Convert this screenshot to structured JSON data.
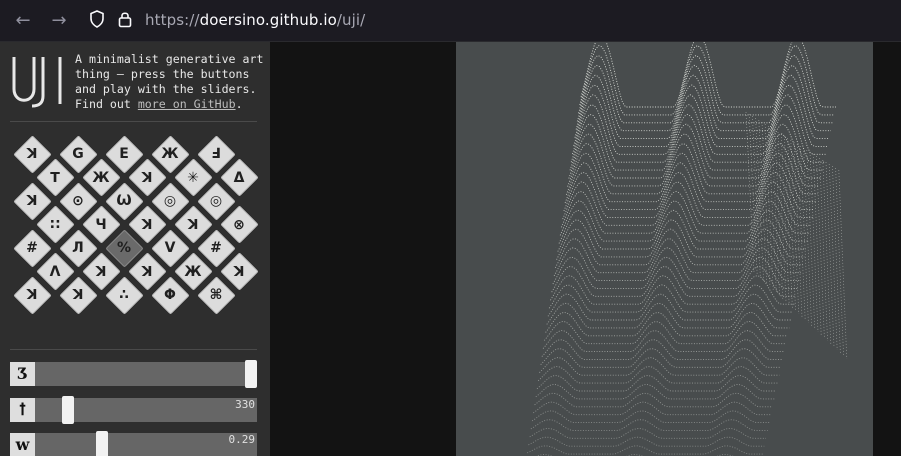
{
  "browser": {
    "url_prefix": "https://",
    "url_host": "doersino.github.io",
    "url_path": "/uji/",
    "icons": [
      "back-arrow-icon",
      "forward-arrow-icon",
      "shield-icon",
      "lock-icon"
    ]
  },
  "intro": {
    "text": "A minimalist generative art thing – press the buttons and play with the sliders. Find out ",
    "link": "more on GitHub",
    "end": "."
  },
  "presets": [
    [
      "ꓘ",
      "G",
      "E",
      "Ж",
      "Ⅎ"
    ],
    [
      "ꓔ",
      "Ж",
      "ꓘ",
      "✳",
      "Δ",
      "⊘"
    ],
    [
      "ꓘ",
      "⊙",
      "Ѡ",
      "◎",
      "◎",
      "∷"
    ],
    [
      "∷",
      "Ч",
      "ꓘ",
      "ꓘ",
      "⊗"
    ],
    [
      "#",
      "Л",
      "%",
      "V",
      "#"
    ],
    [
      "Λ",
      "ꓘ",
      "ꓘ",
      "Ж",
      "ꓘ"
    ],
    [
      "ꓘ",
      "ꓘ",
      "∴",
      "Φ",
      "⌘"
    ]
  ],
  "selected_preset": "row4-col2",
  "sliders": [
    {
      "icon": "Ʒ",
      "value": "",
      "fraction": 1.0
    },
    {
      "icon": "ꝉ",
      "value": "330",
      "fraction": 0.13
    },
    {
      "icon": "w",
      "value": "0.29",
      "fraction": 0.29
    }
  ],
  "colors": {
    "canvas_bg": "#484c4d",
    "sidebar_bg": "#2e2e2e",
    "wave": "#e9ece6"
  }
}
